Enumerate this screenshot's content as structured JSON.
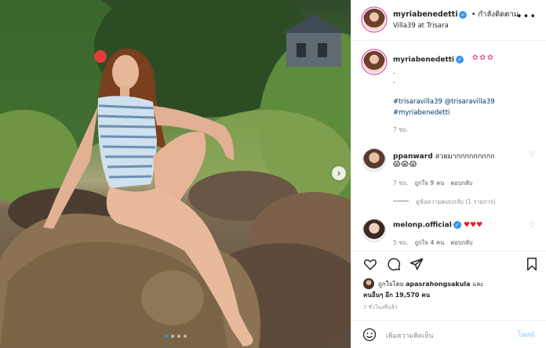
{
  "post": {
    "username": "myriabenedetti",
    "verified_mark": "✓",
    "follow_status": "• กำลังติดตาม",
    "location": "Villa39 at Trisara",
    "more_icon": "more-dots-icon",
    "photo_description_dots": {
      "count": 4,
      "active": 0
    }
  },
  "caption": {
    "username": "myriabenedetti",
    "flowers": "✿✿✿",
    "dots": [
      ".",
      "."
    ],
    "hashtag1": "#trisaravilla39",
    "mention": "@trisaravilla39",
    "hashtag2": "#myriabenedetti",
    "time": "7 ชม."
  },
  "comments": [
    {
      "username": "ppanward",
      "text": "สวยมากกกกกกกกก",
      "emoji": "😱😱😱",
      "time": "7 ชม.",
      "likes": "ถูกใจ 9 คน",
      "reply": "ตอบกลับ",
      "view_replies": "ดูข้อความตอบกลับ (1 รายการ)"
    },
    {
      "username": "melonp.official",
      "verified_mark": "✓",
      "hearts": "♥♥♥",
      "time": "5 ชม.",
      "likes": "ถูกใจ 4 คน",
      "reply": "ตอบกลับ"
    }
  ],
  "likes": {
    "line1_prefix": "ถูกใจโดย",
    "liker": "apasrahongsakula",
    "line1_suffix": "และ",
    "line2": "คนอื่นๆ อีก 19,570 คน"
  },
  "timestamp": "7 ชั่วโมงที่แล้ว",
  "comment_input": {
    "placeholder": "เพิ่มความคิดเห็น",
    "post_label": "โพสต์"
  },
  "colors": {
    "verified": "#3897f0",
    "link": "#00376b",
    "post_button": "#b2dffc",
    "active_dot": "#2196f3"
  }
}
